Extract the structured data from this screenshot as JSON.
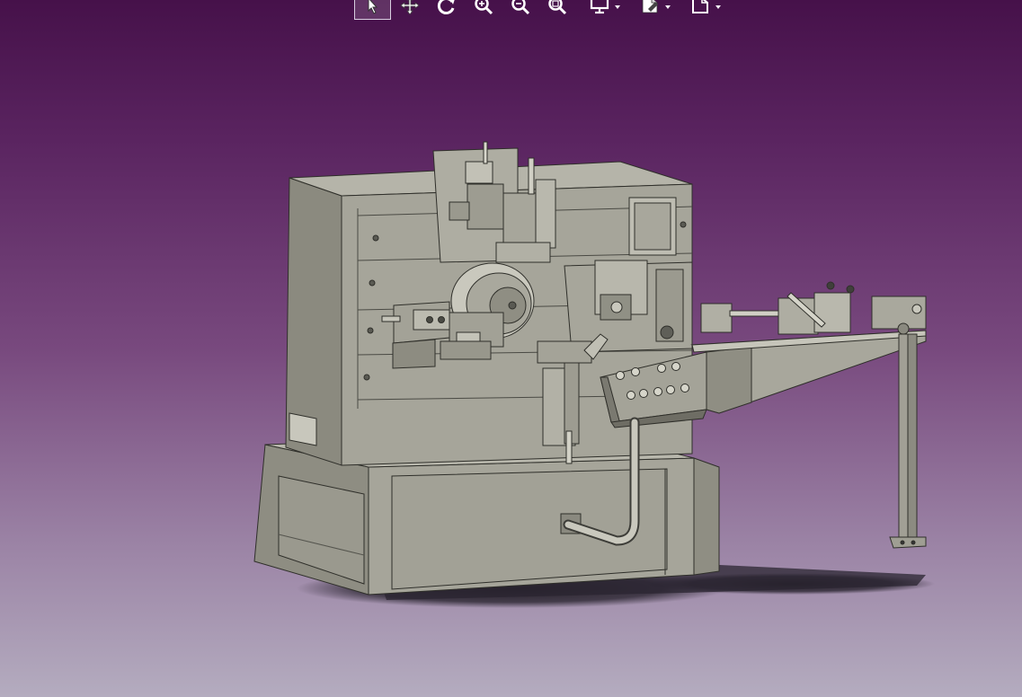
{
  "viewer": {
    "background_top": "#46114a",
    "background_bottom": "#b4acbf",
    "model_color": "#a3a296"
  },
  "toolbar": {
    "buttons": [
      {
        "icon": "select-arrow-icon",
        "active": true
      },
      {
        "icon": "pan-icon",
        "active": false
      },
      {
        "icon": "rotate-icon",
        "active": false
      },
      {
        "icon": "zoom-in-icon",
        "active": false
      },
      {
        "icon": "zoom-out-icon",
        "active": false
      },
      {
        "icon": "zoom-area-icon",
        "active": false
      },
      {
        "icon": "view-display-icon",
        "active": false,
        "dropdown": true
      },
      {
        "icon": "render-style-icon",
        "active": false,
        "dropdown": true
      },
      {
        "icon": "hide-show-icon",
        "active": false,
        "dropdown": true
      }
    ]
  }
}
